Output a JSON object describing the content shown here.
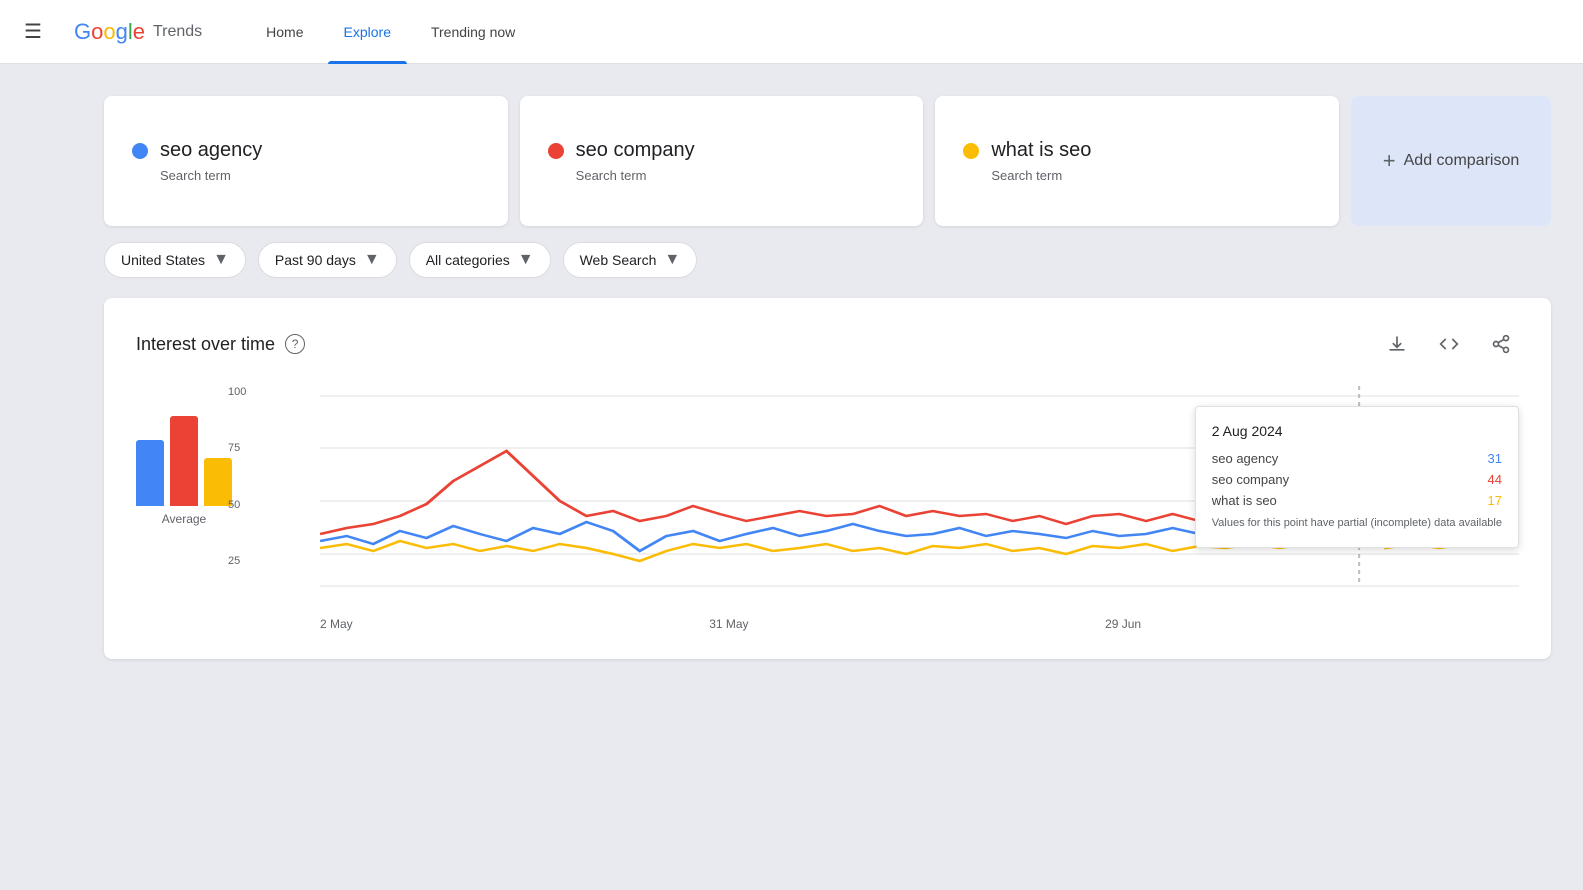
{
  "header": {
    "menu_icon": "☰",
    "logo": {
      "letters": [
        "G",
        "o",
        "o",
        "g",
        "l",
        "e"
      ],
      "trends": "Trends"
    },
    "nav": [
      {
        "label": "Home",
        "active": false
      },
      {
        "label": "Explore",
        "active": true
      },
      {
        "label": "Trending now",
        "active": false
      }
    ]
  },
  "terms": [
    {
      "name": "seo agency",
      "type": "Search term",
      "color": "#4285F4"
    },
    {
      "name": "seo company",
      "type": "Search term",
      "color": "#EA4335"
    },
    {
      "name": "what is seo",
      "type": "Search term",
      "color": "#FBBC05"
    }
  ],
  "add_comparison": {
    "plus": "+",
    "label": "Add comparison"
  },
  "filters": [
    {
      "label": "United States",
      "id": "region"
    },
    {
      "label": "Past 90 days",
      "id": "period"
    },
    {
      "label": "All categories",
      "id": "category"
    },
    {
      "label": "Web Search",
      "id": "search_type"
    }
  ],
  "chart": {
    "title": "Interest over time",
    "y_labels": [
      "100",
      "75",
      "50",
      "25"
    ],
    "x_labels": [
      "2 May",
      "31 May",
      "29 Jun"
    ],
    "avg_label": "Average",
    "tooltip": {
      "date": "2 Aug 2024",
      "rows": [
        {
          "term": "seo agency",
          "value": "31",
          "color": "#4285F4"
        },
        {
          "term": "seo company",
          "value": "44",
          "color": "#EA4335"
        },
        {
          "term": "what is seo",
          "value": "17",
          "color": "#FBBC05"
        }
      ],
      "note": "Values for this point have partial (incomplete) data available"
    },
    "bars": [
      {
        "color": "#4285F4",
        "height_pct": 55
      },
      {
        "color": "#EA4335",
        "height_pct": 75
      },
      {
        "color": "#FBBC05",
        "height_pct": 40
      }
    ]
  },
  "icons": {
    "download": "⬇",
    "embed": "<>",
    "share": "↗",
    "help": "?"
  }
}
